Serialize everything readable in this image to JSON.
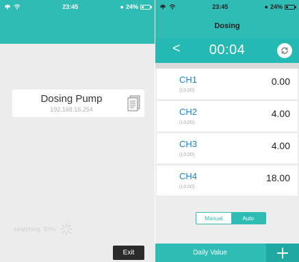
{
  "left": {
    "status": {
      "time": "23:45",
      "battery": "24%",
      "battery_level": 0.24
    },
    "device": {
      "name": "Dosing Pump",
      "ip": "192.168.16.254"
    },
    "searching": {
      "text": "searching",
      "percent": "30%"
    },
    "exit_label": "Exit"
  },
  "right": {
    "status": {
      "time": "23:45",
      "battery": "24%",
      "battery_level": 0.24
    },
    "title": "Dosing",
    "back_label": "<",
    "timer": "00:04",
    "channels": [
      {
        "name": "CH1",
        "sub": "(L0.00)",
        "value": "0.00"
      },
      {
        "name": "CH2",
        "sub": "(L0.00)",
        "value": "4.00"
      },
      {
        "name": "CH3",
        "sub": "(L0.00)",
        "value": "4.00"
      },
      {
        "name": "CH4",
        "sub": "(L0.00)",
        "value": "18.00"
      }
    ],
    "mode": {
      "manual": "Manual",
      "auto": "Auto",
      "selected": "Auto"
    },
    "daily_value_label": "Daily Value",
    "add_label": "+"
  },
  "colors": {
    "accent": "#2ebcb5",
    "channel_name": "#1b82d6"
  },
  "icons": [
    "airplane-icon",
    "wifi-icon",
    "alarm-icon",
    "battery-icon",
    "document-icon",
    "spinner-icon",
    "refresh-icon",
    "plus-icon"
  ]
}
